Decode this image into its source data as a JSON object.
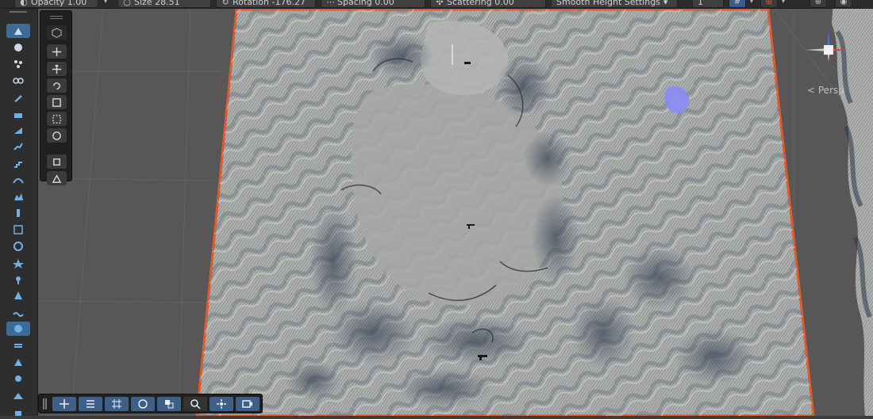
{
  "toolbar": {
    "opacity": "Opacity 1.00",
    "size": "Size 28.51",
    "rotation": "Rotation -176.27",
    "spacing": "Spacing 0.00",
    "scattering": "Scattering 0.00",
    "smooth_height": "Smooth Height Settings",
    "value_field": "1"
  },
  "viewport": {
    "projection_label": "< Persp"
  },
  "colors": {
    "terrain": "#a8aaa8",
    "terrain_outline": "#e25a2a",
    "background": "#585656",
    "accent": "#3e6a96"
  },
  "icons": {
    "left_strip": [
      "raise-lower-icon",
      "paint-holes-icon",
      "paint-texture-icon",
      "stamp-icon",
      "brush-icon",
      "set-height-icon",
      "smooth-height-icon",
      "slope-flatten-icon",
      "terrace-icon",
      "contrast-icon",
      "sharpen-peaks-icon",
      "noise-icon",
      "pinch-icon",
      "twist-icon",
      "smudge-icon",
      "stamp-terrain-icon",
      "erosion-icon",
      "wind-erosion-icon",
      "thermal-erosion-icon",
      "hydraulic-erosion-icon",
      "bridge-icon",
      "clone-icon",
      "ridge-icon",
      "mesa-icon"
    ],
    "tool_panel": [
      "view-tool-icon",
      "move-tool-icon",
      "rotate-tool-icon",
      "scale-tool-icon",
      "rect-tool-icon",
      "transform-tool-icon",
      "custom-tool-icon",
      "terrain-tool-icon"
    ],
    "bottom_bar": [
      "move-icon",
      "settings-icon",
      "grid-icon",
      "circle-icon",
      "layers-icon",
      "search-icon",
      "center-icon",
      "camera-icon"
    ]
  }
}
